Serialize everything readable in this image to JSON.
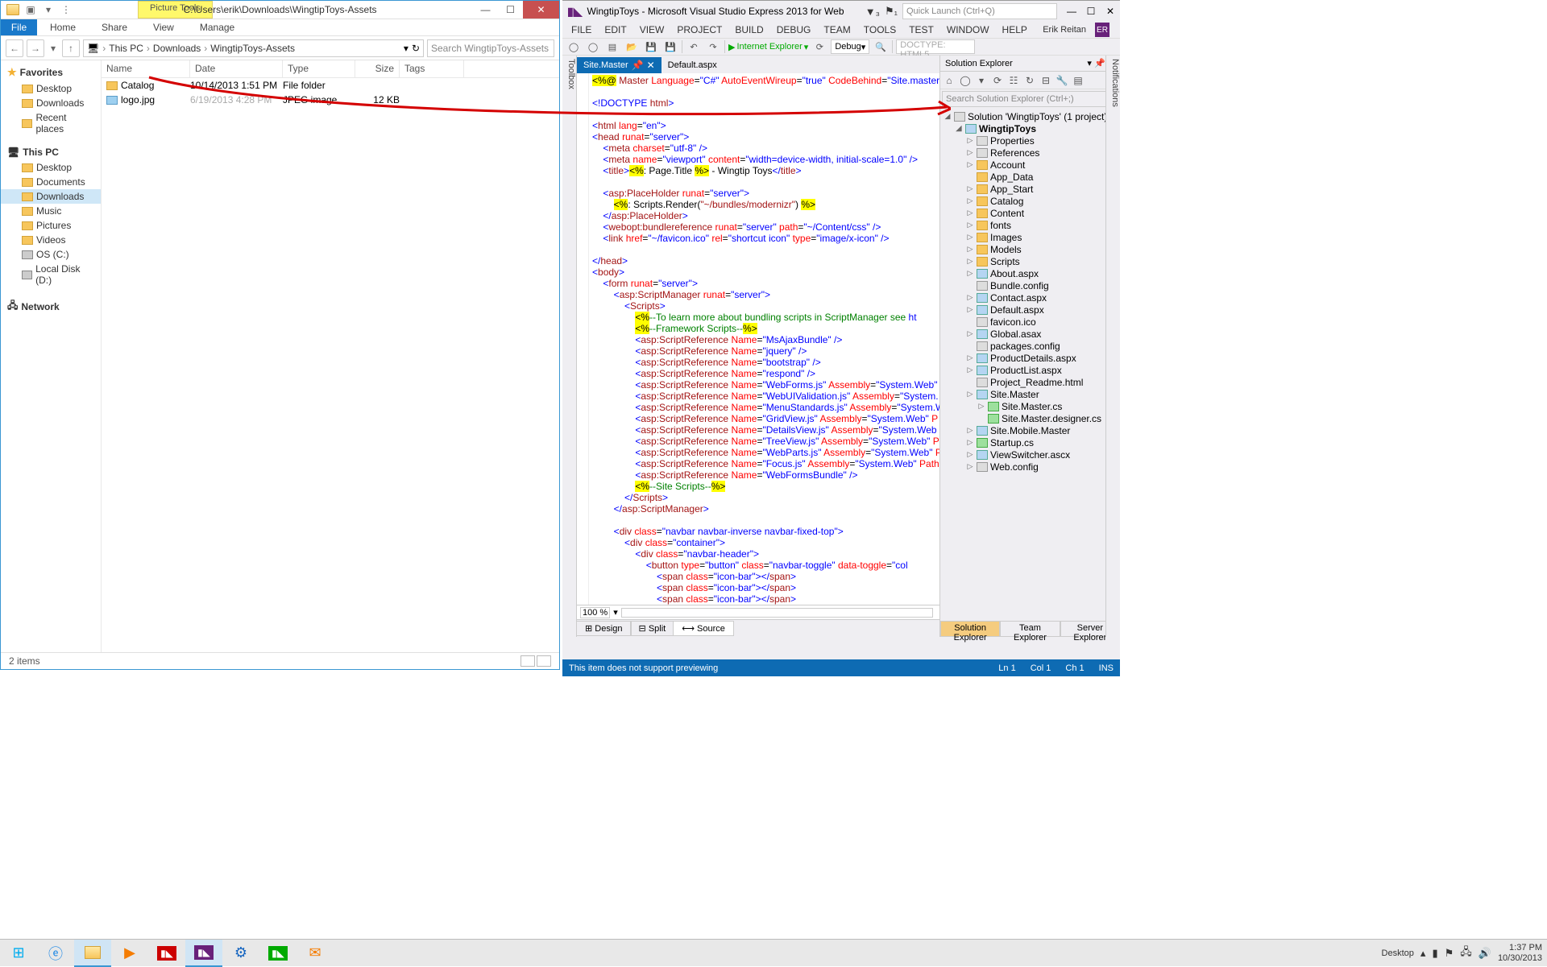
{
  "explorer": {
    "title_path": "C:\\Users\\erik\\Downloads\\WingtipToys-Assets",
    "picture_tools_label": "Picture Tools",
    "ribbon": {
      "file": "File",
      "home": "Home",
      "share": "Share",
      "view": "View",
      "manage": "Manage"
    },
    "breadcrumbs": [
      "This PC",
      "Downloads",
      "WingtipToys-Assets"
    ],
    "search_placeholder": "Search WingtipToys-Assets",
    "nav": {
      "favorites": {
        "header": "Favorites",
        "items": [
          "Desktop",
          "Downloads",
          "Recent places"
        ]
      },
      "this_pc": {
        "header": "This PC",
        "items": [
          "Desktop",
          "Documents",
          "Downloads",
          "Music",
          "Pictures",
          "Videos",
          "OS (C:)",
          "Local Disk (D:)"
        ]
      },
      "network": {
        "header": "Network"
      }
    },
    "columns": {
      "name": "Name",
      "date": "Date",
      "type": "Type",
      "size": "Size",
      "tags": "Tags"
    },
    "rows": [
      {
        "name": "Catalog",
        "date": "10/14/2013 1:51 PM",
        "type": "File folder",
        "size": "",
        "icon": "folder"
      },
      {
        "name": "logo.jpg",
        "date": "6/19/2013 4:28 PM",
        "type": "JPEG image",
        "size": "12 KB",
        "icon": "image"
      }
    ],
    "status": "2 items"
  },
  "vs": {
    "title": "WingtipToys - Microsoft Visual Studio Express 2013 for Web",
    "quick_launch": "Quick Launch (Ctrl+Q)",
    "menu": [
      "FILE",
      "EDIT",
      "VIEW",
      "PROJECT",
      "BUILD",
      "DEBUG",
      "TEAM",
      "TOOLS",
      "TEST",
      "WINDOW",
      "HELP"
    ],
    "signin_name": "Erik Reitan",
    "signin_initials": "ER",
    "toolbar": {
      "browser": "Internet Explorer",
      "config": "Debug",
      "doctype": "DOCTYPE: HTML5"
    },
    "toolbox_label": "Toolbox",
    "tabs": [
      {
        "name": "Site.Master",
        "active": true
      },
      {
        "name": "Default.aspx",
        "active": false
      }
    ],
    "zoom": "100 %",
    "view_tabs": {
      "design": "Design",
      "split": "Split",
      "source": "Source"
    },
    "status_msg": "This item does not support previewing",
    "status_pos": {
      "line": "Ln 1",
      "col": "Col 1",
      "ch": "Ch 1",
      "ins": "INS"
    },
    "solution": {
      "header": "Solution Explorer",
      "search_placeholder": "Search Solution Explorer (Ctrl+;)",
      "root": "Solution 'WingtipToys' (1 project)",
      "project": "WingtipToys",
      "nodes": [
        {
          "name": "Properties",
          "icon": "wrench",
          "exp": true
        },
        {
          "name": "References",
          "icon": "ref",
          "exp": true
        },
        {
          "name": "Account",
          "icon": "folder",
          "exp": true
        },
        {
          "name": "App_Data",
          "icon": "folder",
          "exp": false
        },
        {
          "name": "App_Start",
          "icon": "folder",
          "exp": true
        },
        {
          "name": "Catalog",
          "icon": "folder",
          "exp": true
        },
        {
          "name": "Content",
          "icon": "folder",
          "exp": true
        },
        {
          "name": "fonts",
          "icon": "folder",
          "exp": true
        },
        {
          "name": "Images",
          "icon": "folder",
          "exp": true
        },
        {
          "name": "Models",
          "icon": "folder",
          "exp": true
        },
        {
          "name": "Scripts",
          "icon": "folder",
          "exp": true
        },
        {
          "name": "About.aspx",
          "icon": "aspx",
          "exp": true
        },
        {
          "name": "Bundle.config",
          "icon": "cfg",
          "exp": false
        },
        {
          "name": "Contact.aspx",
          "icon": "aspx",
          "exp": true
        },
        {
          "name": "Default.aspx",
          "icon": "aspx",
          "exp": true
        },
        {
          "name": "favicon.ico",
          "icon": "cfg",
          "exp": false
        },
        {
          "name": "Global.asax",
          "icon": "aspx",
          "exp": true
        },
        {
          "name": "packages.config",
          "icon": "cfg",
          "exp": false
        },
        {
          "name": "ProductDetails.aspx",
          "icon": "aspx",
          "exp": true
        },
        {
          "name": "ProductList.aspx",
          "icon": "aspx",
          "exp": true
        },
        {
          "name": "Project_Readme.html",
          "icon": "cfg",
          "exp": false
        },
        {
          "name": "Site.Master",
          "icon": "aspx",
          "exp": true,
          "open": true,
          "children": [
            {
              "name": "Site.Master.cs",
              "icon": "cs",
              "exp": true
            },
            {
              "name": "Site.Master.designer.cs",
              "icon": "cs",
              "exp": false
            }
          ]
        },
        {
          "name": "Site.Mobile.Master",
          "icon": "aspx",
          "exp": true
        },
        {
          "name": "Startup.cs",
          "icon": "cs",
          "exp": true
        },
        {
          "name": "ViewSwitcher.ascx",
          "icon": "aspx",
          "exp": true
        },
        {
          "name": "Web.config",
          "icon": "cfg",
          "exp": true
        }
      ],
      "bottom_tabs": [
        "Solution Explorer",
        "Team Explorer",
        "Server Explorer"
      ]
    },
    "notifications_label": "Notifications"
  },
  "taskbar": {
    "desktop_label": "Desktop",
    "clock_time": "1:37 PM",
    "clock_date": "10/30/2013"
  }
}
